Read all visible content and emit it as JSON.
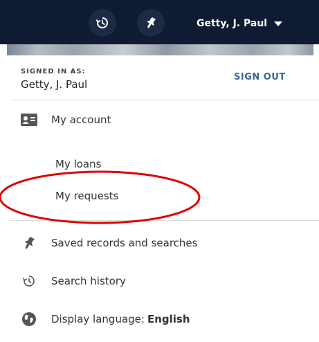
{
  "header": {
    "user_name": "Getty, J. Paul",
    "history_icon": "history-icon",
    "pin_icon": "pin-icon"
  },
  "dropdown": {
    "signed_in_label": "SIGNED IN AS:",
    "signed_in_name": "Getty, J. Paul",
    "sign_out_label": "SIGN OUT",
    "items": [
      {
        "label": "My account",
        "icon": "id-card-icon"
      },
      {
        "label": "My loans"
      },
      {
        "label": "My requests"
      },
      {
        "label": "Saved records and searches",
        "icon": "pin-icon"
      },
      {
        "label": "Search history",
        "icon": "history-icon"
      },
      {
        "label": "Display language:",
        "value": "English",
        "icon": "globe-icon"
      }
    ]
  },
  "colors": {
    "topbar": "#0e1b33",
    "sign_out": "#3c6690",
    "annotation": "#e00000"
  }
}
